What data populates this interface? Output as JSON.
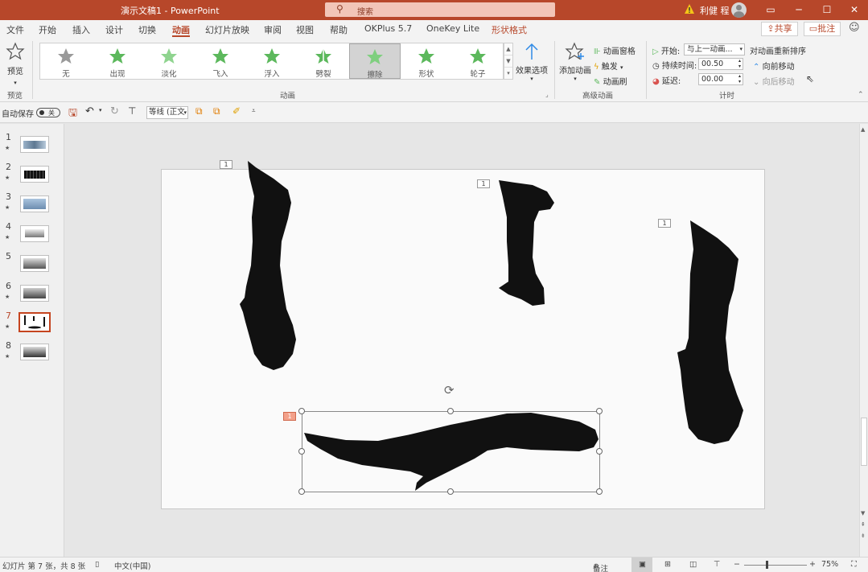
{
  "titlebar": {
    "title": "演示文稿1  -  PowerPoint",
    "search_icon": "search-icon",
    "search_placeholder": "搜索",
    "user_name": "利健 程",
    "ribbon_display_icon": "ribbon-display-icon",
    "minimize": "─",
    "maximize": "☐",
    "close": "✕"
  },
  "menu": {
    "tabs": [
      "文件",
      "开始",
      "插入",
      "设计",
      "切换",
      "动画",
      "幻灯片放映",
      "审阅",
      "视图",
      "帮助",
      "OKPlus 5.7",
      "OneKey Lite",
      "形状格式"
    ],
    "active_tab": "动画",
    "share": "共享",
    "comment": "批注"
  },
  "ribbon": {
    "preview": {
      "label": "预览",
      "group": "预览"
    },
    "animations": [
      {
        "label": "无",
        "icon": "star-gray-icon"
      },
      {
        "label": "出现",
        "icon": "star-green-icon"
      },
      {
        "label": "淡化",
        "icon": "star-green-icon"
      },
      {
        "label": "飞入",
        "icon": "star-green-icon"
      },
      {
        "label": "浮入",
        "icon": "star-green-icon"
      },
      {
        "label": "劈裂",
        "icon": "star-green-icon"
      },
      {
        "label": "擦除",
        "icon": "star-green-icon",
        "selected": true
      },
      {
        "label": "形状",
        "icon": "star-green-icon"
      },
      {
        "label": "轮子",
        "icon": "star-green-icon"
      }
    ],
    "animation_group": "动画",
    "effect_options": "效果选项",
    "add_animation": "添加动画",
    "animation_pane": "动画窗格",
    "trigger": "触发",
    "animation_painter": "动画刷",
    "advanced_group": "高级动画",
    "start_label": "开始:",
    "start_value": "与上一动画...",
    "duration_label": "持续时间:",
    "duration_value": "00.50",
    "delay_label": "延迟:",
    "delay_value": "00.00",
    "reorder_title": "对动画重新排序",
    "move_earlier": "向前移动",
    "move_later": "向后移动",
    "timing_group": "计时"
  },
  "qat": {
    "autosave": "自动保存",
    "toggle_state": "关",
    "font_name": "等线 (正文"
  },
  "thumbnails": [
    {
      "num": "1",
      "star": "★"
    },
    {
      "num": "2",
      "star": "★"
    },
    {
      "num": "3",
      "star": "★"
    },
    {
      "num": "4",
      "star": "★"
    },
    {
      "num": "5",
      "star": "★"
    },
    {
      "num": "6",
      "star": "★"
    },
    {
      "num": "7",
      "star": "★",
      "current": true
    },
    {
      "num": "8",
      "star": "★"
    }
  ],
  "slide": {
    "anim_tags": [
      "1",
      "1",
      "1",
      "1"
    ]
  },
  "status": {
    "slide_info": "幻灯片 第 7 张，共 8 张",
    "language": "中文(中国)",
    "notes": "备注",
    "zoom": "75%"
  }
}
